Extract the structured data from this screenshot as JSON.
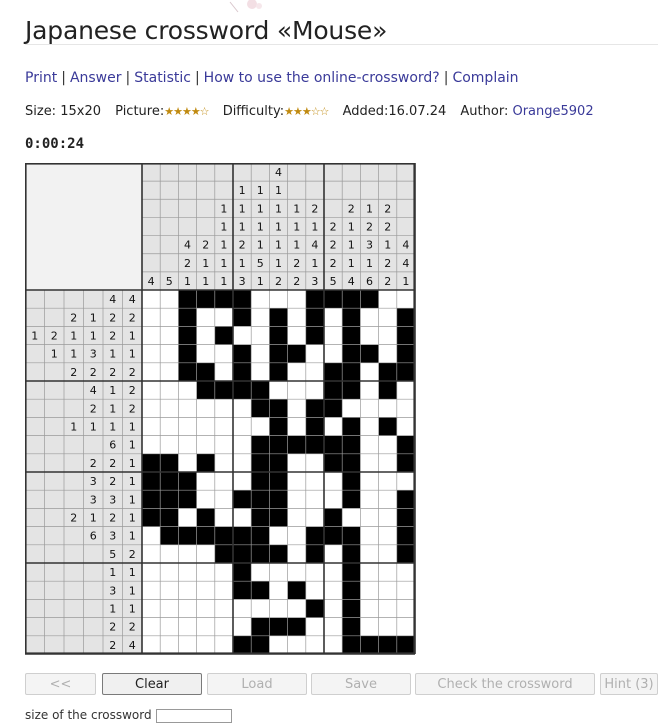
{
  "title": "Japanese crossword «Mouse»",
  "links": [
    "Print",
    "Answer",
    "Statistic",
    "How to use the online-crossword?",
    "Complain"
  ],
  "info": {
    "size_label": "Size:",
    "size": "15x20",
    "picture_label": "Picture:",
    "picture_stars": "★★★★☆",
    "difficulty_label": "Difficulty:",
    "difficulty_stars": "★★★☆☆",
    "added_label": "Added:",
    "added": "16.07.24",
    "author_label": "Author:",
    "author": "Orange5902"
  },
  "timer": "0:00:24",
  "column_clues": [
    [
      "4"
    ],
    [
      "5"
    ],
    [
      "4",
      "2",
      "1"
    ],
    [
      "2",
      "1",
      "1"
    ],
    [
      "1",
      "1",
      "1",
      "1",
      "1"
    ],
    [
      "1",
      "1",
      "1",
      "2",
      "1",
      "3"
    ],
    [
      "1",
      "1",
      "1",
      "1",
      "5",
      "1"
    ],
    [
      "4",
      "1",
      "1",
      "1",
      "1",
      "1",
      "2"
    ],
    [
      "1",
      "1",
      "1",
      "2",
      "2"
    ],
    [
      "2",
      "1",
      "4",
      "1",
      "3"
    ],
    [
      "2",
      "2",
      "2",
      "5"
    ],
    [
      "2",
      "1",
      "1",
      "1",
      "4"
    ],
    [
      "1",
      "2",
      "3",
      "1",
      "6"
    ],
    [
      "2",
      "2",
      "1",
      "2",
      "2"
    ],
    [
      "4",
      "4",
      "1"
    ]
  ],
  "row_clues": [
    [
      "4",
      "4"
    ],
    [
      "2",
      "1",
      "2",
      "2"
    ],
    [
      "1",
      "2",
      "1",
      "1",
      "2",
      "1"
    ],
    [
      "1",
      "1",
      "3",
      "1",
      "1"
    ],
    [
      "2",
      "2",
      "2",
      "2"
    ],
    [
      "4",
      "1",
      "2"
    ],
    [
      "2",
      "1",
      "2"
    ],
    [
      "1",
      "1",
      "1",
      "1"
    ],
    [
      "6",
      "1"
    ],
    [
      "2",
      "2",
      "1"
    ],
    [
      "3",
      "2",
      "1"
    ],
    [
      "3",
      "3",
      "1"
    ],
    [
      "2",
      "1",
      "2",
      "1"
    ],
    [
      "6",
      "3",
      "1"
    ],
    [
      "5",
      "2"
    ],
    [
      "1",
      "1"
    ],
    [
      "3",
      "1"
    ],
    [
      "1",
      "1"
    ],
    [
      "2",
      "2"
    ],
    [
      "2",
      "4"
    ]
  ],
  "grid_rows": [
    "..XXXX...XXXX..",
    "..X..X.X.X.X..X",
    "..X.X..X.X.X..X",
    "..X..X.XX..XX.X",
    "..XX.X.X..XX.XX",
    "...XXXX...XX.X.",
    "......XX.XX....",
    ".......X.X.X.X.",
    "......XXXXXX..X",
    "XX.X..XX..XX..X",
    "XXX...XX...X...",
    "XXX..XXX...X..X",
    "XX.X..XX..X...X",
    ".XXXXXX..XXX..X",
    "....XXXX.X.X..X",
    ".....X.....X...",
    ".....XX.X..X...",
    ".........X.X...",
    "......XXX..X...",
    ".....XX....XXXX"
  ],
  "buttons": [
    {
      "label": "<<",
      "enabled": false
    },
    {
      "label": "Clear",
      "enabled": true
    },
    {
      "label": "Load",
      "enabled": false
    },
    {
      "label": "Save",
      "enabled": false
    },
    {
      "label": "Check the crossword",
      "enabled": false
    },
    {
      "label": "Hint (3)",
      "enabled": false
    }
  ],
  "bottom_text": "size of the crossword"
}
